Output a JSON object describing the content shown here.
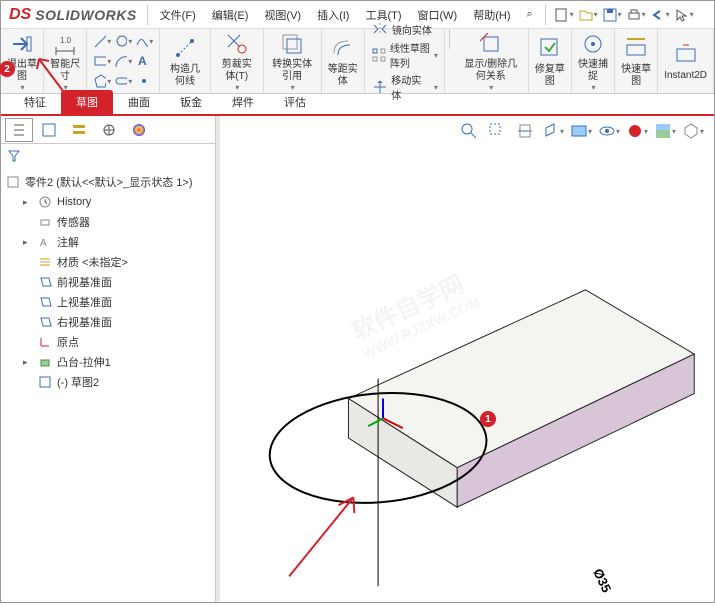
{
  "app": {
    "name": "SOLIDWORKS"
  },
  "menu": {
    "file": "文件(F)",
    "edit": "编辑(E)",
    "view": "视图(V)",
    "insert": "插入(I)",
    "tools": "工具(T)",
    "window": "窗口(W)",
    "help": "帮助(H)",
    "search": "⌕"
  },
  "ribbon": {
    "exit_sketch": "退出草图",
    "smart_dim": "智能尺寸",
    "construction": "构造几何线",
    "trim": "剪裁实体(T)",
    "convert": "转换实体引用",
    "offset": "等距实体",
    "mirror": "镜向实体",
    "pattern": "线性草图阵列",
    "move": "移动实体",
    "display_delete": "显示/删除几何关系",
    "repair": "修复草图",
    "quicksnap": "快速捕捉",
    "rapid": "快速草图",
    "instant": "Instant2D"
  },
  "cmdtabs": {
    "features": "特征",
    "sketch": "草图",
    "surfaces": "曲面",
    "sheetmetal": "钣金",
    "weldments": "焊件",
    "evaluate": "评估"
  },
  "tree": {
    "root": "零件2 (默认<<默认>_显示状态 1>)",
    "history": "History",
    "sensors": "传感器",
    "annotations": "注解",
    "material": "材质 <未指定>",
    "front": "前视基准面",
    "top": "上视基准面",
    "right": "右视基准面",
    "origin": "原点",
    "extrude": "凸台-拉伸1",
    "sketch2": "(-) 草图2"
  },
  "callout": {
    "b1": "1",
    "b2": "2"
  },
  "dim": "Ø35",
  "watermark": {
    "l1": "软件自学网",
    "l2": "WWW.RJZXW.COM"
  }
}
